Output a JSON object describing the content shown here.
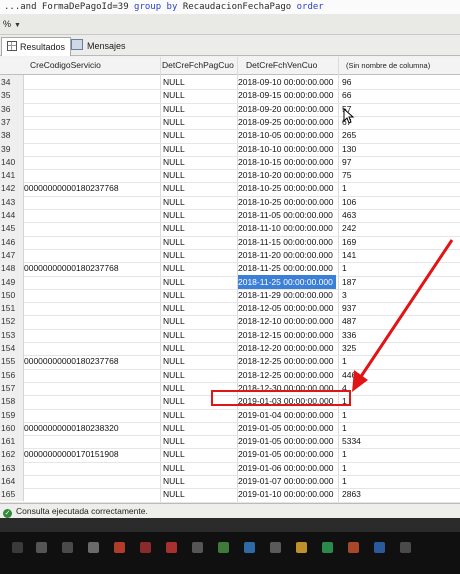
{
  "sql_fragment": {
    "prefix": "...and FormaDePagoId=39 ",
    "kw1": "group by",
    "mid": " RecaudacionFechaPago ",
    "kw2": "order"
  },
  "zoom": {
    "value": "%"
  },
  "tabs": [
    {
      "label": "Resultados",
      "active": true
    },
    {
      "label": "Mensajes",
      "active": false
    }
  ],
  "columns": [
    "CreCodigoServicio",
    "DetCreFchPagCuo",
    "DetCreFchVenCuo",
    "(Sin nombre de columna)"
  ],
  "rows": [
    {
      "n": "34",
      "code": "",
      "pag": "NULL",
      "ven": "2018-09-10 00:00:00.000",
      "val": "96"
    },
    {
      "n": "35",
      "code": "",
      "pag": "NULL",
      "ven": "2018-09-15 00:00:00.000",
      "val": "66"
    },
    {
      "n": "36",
      "code": "",
      "pag": "NULL",
      "ven": "2018-09-20 00:00:00.000",
      "val": "57"
    },
    {
      "n": "37",
      "code": "",
      "pag": "NULL",
      "ven": "2018-09-25 00:00:00.000",
      "val": "67"
    },
    {
      "n": "38",
      "code": "",
      "pag": "NULL",
      "ven": "2018-10-05 00:00:00.000",
      "val": "265"
    },
    {
      "n": "39",
      "code": "",
      "pag": "NULL",
      "ven": "2018-10-10 00:00:00.000",
      "val": "130"
    },
    {
      "n": "140",
      "code": "",
      "pag": "NULL",
      "ven": "2018-10-15 00:00:00.000",
      "val": "97"
    },
    {
      "n": "141",
      "code": "",
      "pag": "NULL",
      "ven": "2018-10-20 00:00:00.000",
      "val": "75"
    },
    {
      "n": "142",
      "code": "00000000000180237768",
      "pag": "NULL",
      "ven": "2018-10-25 00:00:00.000",
      "val": "1"
    },
    {
      "n": "143",
      "code": "",
      "pag": "NULL",
      "ven": "2018-10-25 00:00:00.000",
      "val": "106"
    },
    {
      "n": "144",
      "code": "",
      "pag": "NULL",
      "ven": "2018-11-05 00:00:00.000",
      "val": "463"
    },
    {
      "n": "145",
      "code": "",
      "pag": "NULL",
      "ven": "2018-11-10 00:00:00.000",
      "val": "242"
    },
    {
      "n": "146",
      "code": "",
      "pag": "NULL",
      "ven": "2018-11-15 00:00:00.000",
      "val": "169"
    },
    {
      "n": "147",
      "code": "",
      "pag": "NULL",
      "ven": "2018-11-20 00:00:00.000",
      "val": "141"
    },
    {
      "n": "148",
      "code": "00000000000180237768",
      "pag": "NULL",
      "ven": "2018-11-25 00:00:00.000",
      "val": "1"
    },
    {
      "n": "149",
      "code": "",
      "pag": "NULL",
      "ven": "2018-11-25 00:00:00.000",
      "val": "187",
      "selected": true
    },
    {
      "n": "150",
      "code": "",
      "pag": "NULL",
      "ven": "2018-11-29 00:00:00.000",
      "val": "3"
    },
    {
      "n": "151",
      "code": "",
      "pag": "NULL",
      "ven": "2018-12-05 00:00:00.000",
      "val": "937"
    },
    {
      "n": "152",
      "code": "",
      "pag": "NULL",
      "ven": "2018-12-10 00:00:00.000",
      "val": "487"
    },
    {
      "n": "153",
      "code": "",
      "pag": "NULL",
      "ven": "2018-12-15 00:00:00.000",
      "val": "336"
    },
    {
      "n": "154",
      "code": "",
      "pag": "NULL",
      "ven": "2018-12-20 00:00:00.000",
      "val": "325"
    },
    {
      "n": "155",
      "code": "00000000000180237768",
      "pag": "NULL",
      "ven": "2018-12-25 00:00:00.000",
      "val": "1"
    },
    {
      "n": "156",
      "code": "",
      "pag": "NULL",
      "ven": "2018-12-25 00:00:00.000",
      "val": "446"
    },
    {
      "n": "157",
      "code": "",
      "pag": "NULL",
      "ven": "2018-12-30 00:00:00.000",
      "val": "4",
      "highlighted": true
    },
    {
      "n": "158",
      "code": "",
      "pag": "NULL",
      "ven": "2019-01-03 00:00:00.000",
      "val": "1"
    },
    {
      "n": "159",
      "code": "",
      "pag": "NULL",
      "ven": "2019-01-04 00:00:00.000",
      "val": "1"
    },
    {
      "n": "160",
      "code": "00000000000180238320",
      "pag": "NULL",
      "ven": "2019-01-05 00:00:00.000",
      "val": "1"
    },
    {
      "n": "161",
      "code": "",
      "pag": "NULL",
      "ven": "2019-01-05 00:00:00.000",
      "val": "5334"
    },
    {
      "n": "162",
      "code": "00000000000170151908",
      "pag": "NULL",
      "ven": "2019-01-05 00:00:00.000",
      "val": "1"
    },
    {
      "n": "163",
      "code": "",
      "pag": "NULL",
      "ven": "2019-01-06 00:00:00.000",
      "val": "1"
    },
    {
      "n": "164",
      "code": "",
      "pag": "NULL",
      "ven": "2019-01-07 00:00:00.000",
      "val": "1"
    },
    {
      "n": "165",
      "code": "",
      "pag": "NULL",
      "ven": "2019-01-10 00:00:00.000",
      "val": "2863"
    }
  ],
  "status": {
    "text": "Consulta ejecutada correctamente.",
    "icon": "success-check-icon"
  },
  "colors": {
    "annotation": "#e01515",
    "selection": "#3c7fd6",
    "status_ok": "#2e8b3a"
  }
}
